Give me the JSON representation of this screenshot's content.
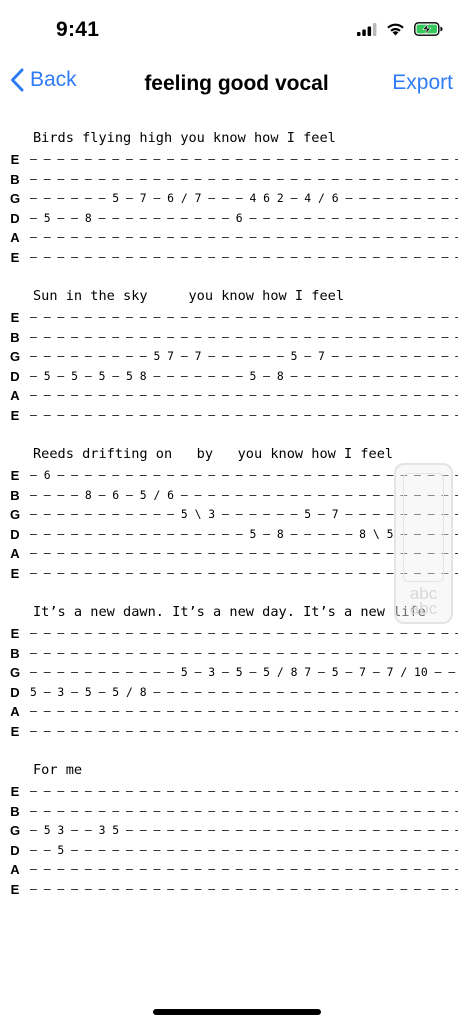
{
  "status_bar": {
    "time": "9:41",
    "icons": [
      "cellular-signal-icon",
      "wifi-icon",
      "battery-charging-icon"
    ],
    "battery_color": "#34c759"
  },
  "nav": {
    "back_label": "Back",
    "title": "feeling good vocal",
    "export_label": "Export",
    "accent_color": "#2f7cf6"
  },
  "stanzas": [
    {
      "lyric": "Birds flying high you know how I feel",
      "strings": [
        {
          "name": "E",
          "tab": "— — — — — — — — — — — — — — — — — — — — — — — — — — — — — — — — — — — — — — — — — — —"
        },
        {
          "name": "B",
          "tab": "— — — — — — — — — — — — — — — — — — — — — — — — — — — — — — — — — — — — — — — — — — —"
        },
        {
          "name": "G",
          "tab": "— — — — — — 5 — 7 — 6 / 7 — — — 4 6 2 — 4 / 6 — — — — — — — — — — — — — — — — —"
        },
        {
          "name": "D",
          "tab": "— 5 — — 8 — — — — — — — — — — 6 — — — — — — — — — — — — — — — — — — — — — — — — — — —"
        },
        {
          "name": "A",
          "tab": "— — — — — — — — — — — — — — — — — — — — — — — — — — — — — — — — — — — — — — — — — — —"
        },
        {
          "name": "E",
          "tab": "— — — — — — — — — — — — — — — — — — — — — — — — — — — — — — — — — — — — — — — — — — —"
        }
      ]
    },
    {
      "lyric": "Sun in the sky     you know how I feel",
      "strings": [
        {
          "name": "E",
          "tab": "— — — — — — — — — — — — — — — — — — — — — — — — — — — — — — — — — — — — — — — — — — —"
        },
        {
          "name": "B",
          "tab": "— — — — — — — — — — — — — — — — — — — — — — — — — — — — — — — — — — — — — — — — — — —"
        },
        {
          "name": "G",
          "tab": "— — — — — — — — — 5 7 — 7 — — — — — — 5 — 7 — — — — — — — — — — — — — — — — — — — —"
        },
        {
          "name": "D",
          "tab": "— 5 — 5 — 5 — 5 8 — — — — — — — 5 — 8 — — — — — — — — — — — — — — — — — — — — — — — —"
        },
        {
          "name": "A",
          "tab": "— — — — — — — — — — — — — — — — — — — — — — — — — — — — — — — — — — — — — — — — — — —"
        },
        {
          "name": "E",
          "tab": "— — — — — — — — — — — — — — — — — — — — — — — — — — — — — — — — — — — — — — — — — — —"
        }
      ]
    },
    {
      "lyric": "Reeds drifting on   by   you know how I feel",
      "strings": [
        {
          "name": "E",
          "tab": "— 6 — — — — — — — — — — — — — — — — — — — — — — — — — — — — — — — — — — — — — — — — —"
        },
        {
          "name": "B",
          "tab": "— — — — 8 — 6 — 5 / 6 — — — — — — — — — — — — — — — — — — — — — — — — — — — — — — — —"
        },
        {
          "name": "G",
          "tab": "— — — — — — — — — — — 5 \\ 3 — — — — — — 5 — 7 — — — — — — — — — — — — — — — — — — —"
        },
        {
          "name": "D",
          "tab": "— — — — — — — — — — — — — — — — 5 — 8 — — — — — 8 \\ 5 — — — — — — — — — — — — — — —"
        },
        {
          "name": "A",
          "tab": "— — — — — — — — — — — — — — — — — — — — — — — — — — — — — — — — — — — — — — — — — — —"
        },
        {
          "name": "E",
          "tab": "— — — — — — — — — — — — — — — — — — — — — — — — — — — — — — — — — — — — — — — — — — —"
        }
      ]
    },
    {
      "lyric": "It’s a new dawn. It’s a new day. It’s a new life",
      "strings": [
        {
          "name": "E",
          "tab": "— — — — — — — — — — — — — — — — — — — — — — — — — — — — — — — — — — — — — — — — — — —"
        },
        {
          "name": "B",
          "tab": "— — — — — — — — — — — — — — — — — — — — — — — — — — — — — — — — — — — — — — — — — — —"
        },
        {
          "name": "G",
          "tab": "— — — — — — — — — — — 5 — 3 — 5 — 5 / 8 7 — 5 — 7 — 7 / 10 — — — — — — — — — — — — —"
        },
        {
          "name": "D",
          "tab": "5 — 3 — 5 — 5 / 8 — — — — — — — — — — — — — — — — — — — — — — — — — — — — — — — — — —"
        },
        {
          "name": "A",
          "tab": "— — — — — — — — — — — — — — — — — — — — — — — — — — — — — — — — — — — — — — — — — — —"
        },
        {
          "name": "E",
          "tab": "— — — — — — — — — — — — — — — — — — — — — — — — — — — — — — — — — — — — — — — — — — —"
        }
      ]
    },
    {
      "lyric": "For me",
      "strings": [
        {
          "name": "E",
          "tab": "— — — — — — — — — — — — — — — — — — — — — — — — — — — — — — — — — — — — — — — — — — —"
        },
        {
          "name": "B",
          "tab": "— — — — — — — — — — — — — — — — — — — — — — — — — — — — — — — — — — — — — — — — — — —"
        },
        {
          "name": "G",
          "tab": "— 5 3 — — 3 5 — — — — — — — — — — — — — — — — — — — — — — — — — — — — — — — — — — — —"
        },
        {
          "name": "D",
          "tab": "— — 5 — — — — — — — — — — — — — — — — — — — — — — — — — — — — — — — — — — — — — — — —"
        },
        {
          "name": "A",
          "tab": "— — — — — — — — — — — — — — — — — — — — — — — — — — — — — — — — — — — — — — — — — — —"
        },
        {
          "name": "E",
          "tab": "— — — — — — — — — — — — — — — — — — — — — — — — — — — — — — — — — — — — — — — — — — —"
        }
      ]
    }
  ],
  "overlay": {
    "watermark_text": "abc abc"
  }
}
